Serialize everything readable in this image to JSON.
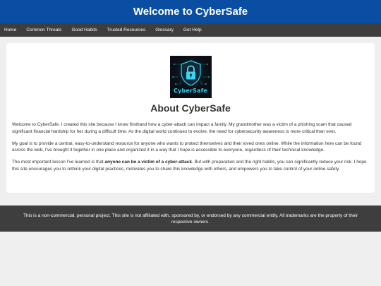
{
  "header": {
    "title": "Welcome to CyberSafe"
  },
  "nav": {
    "items": [
      {
        "label": "Home"
      },
      {
        "label": "Common Threats"
      },
      {
        "label": "Good Habits"
      },
      {
        "label": "Trusted Resources"
      },
      {
        "label": "Glossary"
      },
      {
        "label": "Get Help"
      }
    ]
  },
  "main": {
    "logo": {
      "text": "CyberSafe",
      "icon": "padlock-shield-icon"
    },
    "title": "About CyberSafe",
    "paragraphs": {
      "p1": "Welcome to CyberSafe. I created this site because I know firsthand how a cyber-attack can impact a family. My grandmother was a victim of a phishing scam that caused significant financial hardship for her during a difficult time. As the digital world continues to evolve, the need for cybersecurity awareness is more critical than ever.",
      "p2": "My goal is to provide a central, easy-to-understand resource for anyone who wants to protect themselves and their loved ones online. While the information here can be found across the web, I've brought it together in one place and organized it in a way that I hope is accessible to everyone, regardless of their technical knowledge.",
      "p3_before": "The most important lesson I've learned is that ",
      "p3_bold": "anyone can be a victim of a cyber-attack",
      "p3_after": ". But with preparation and the right habits, you can significantly reduce your risk. I hope this site encourages you to rethink your digital practices, motivates you to share this knowledge with others, and empowers you to take control of your online safety."
    }
  },
  "footer": {
    "text": "This is a non-commercial, personal project. This site is not affiliated with, sponsored by, or endorsed by any commercial entity. All trademarks are the property of their respective owners."
  },
  "colors": {
    "header_bg": "#0a4ea3",
    "nav_bg": "#3e3e3e",
    "page_bg": "#efefef",
    "logo_accent": "#38d6f0"
  }
}
